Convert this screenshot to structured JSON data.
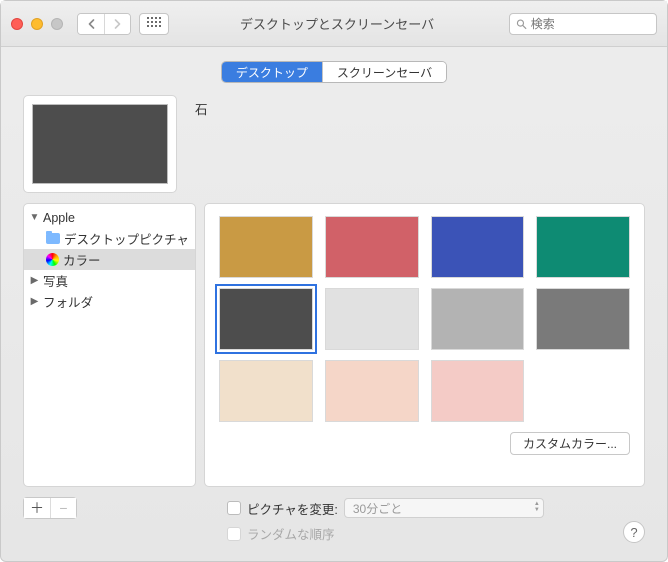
{
  "window": {
    "title": "デスクトップとスクリーンセーバ",
    "search_placeholder": "検索"
  },
  "tabs": {
    "desktop": "デスクトップ",
    "screensaver": "スクリーンセーバ"
  },
  "preview": {
    "label": "石",
    "color": "#4d4d4d"
  },
  "sidebar": {
    "apple": "Apple",
    "desktop_pictures": "デスクトップピクチャ",
    "colors": "カラー",
    "photos": "写真",
    "folders": "フォルダ"
  },
  "swatches": [
    {
      "color": "#c99a44",
      "selected": false
    },
    {
      "color": "#d16168",
      "selected": false
    },
    {
      "color": "#3b53b7",
      "selected": false
    },
    {
      "color": "#0e8b73",
      "selected": false
    },
    {
      "color": "#4d4d4d",
      "selected": true
    },
    {
      "color": "#e1e1e1",
      "selected": false
    },
    {
      "color": "#b3b3b3",
      "selected": false
    },
    {
      "color": "#7a7a7a",
      "selected": false
    },
    {
      "color": "#f1e0cb",
      "selected": false
    },
    {
      "color": "#f5d6c8",
      "selected": false
    },
    {
      "color": "#f4cbc6",
      "selected": false
    }
  ],
  "custom_color_button": "カスタムカラー...",
  "options": {
    "change_picture_label": "ピクチャを変更:",
    "interval": "30分ごと",
    "random_order_label": "ランダムな順序"
  },
  "help_label": "?"
}
